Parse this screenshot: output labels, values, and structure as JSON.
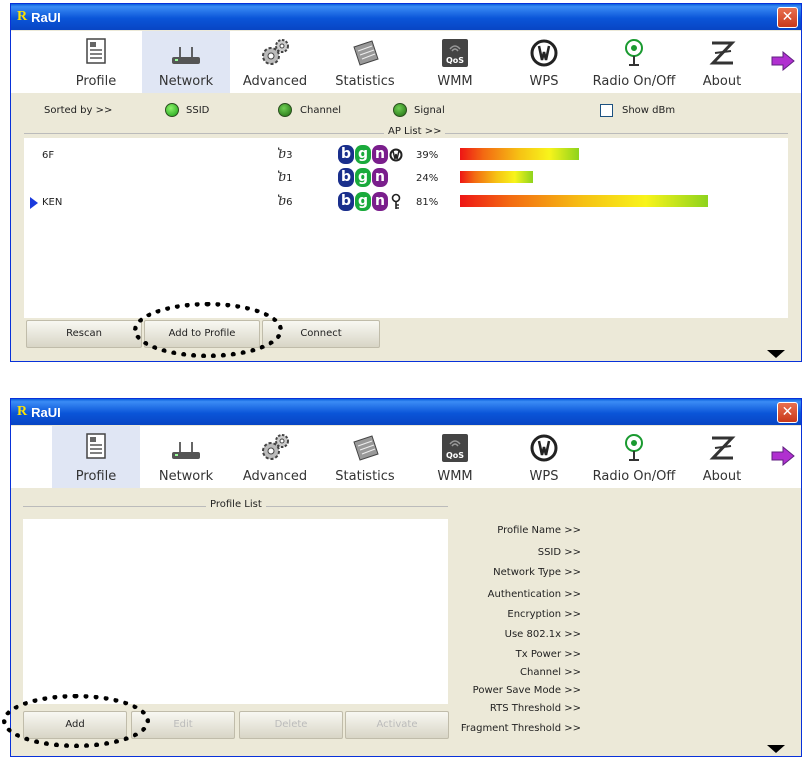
{
  "window1": {
    "title": "RaUI",
    "logo": "R",
    "close": "✕",
    "toolbar": [
      {
        "label": "Profile",
        "icon": "profile-icon",
        "active": false
      },
      {
        "label": "Network",
        "icon": "network-icon",
        "active": true
      },
      {
        "label": "Advanced",
        "icon": "advanced-icon",
        "active": false
      },
      {
        "label": "Statistics",
        "icon": "statistics-icon",
        "active": false
      },
      {
        "label": "WMM",
        "icon": "wmm-icon",
        "active": false
      },
      {
        "label": "WPS",
        "icon": "wps-icon",
        "active": false
      },
      {
        "label": "Radio On/Off",
        "icon": "radio-icon",
        "active": false
      },
      {
        "label": "About",
        "icon": "about-icon",
        "active": false
      }
    ],
    "sortbar": {
      "sorted_by": "Sorted by >>",
      "ssid": "SSID",
      "channel": "Channel",
      "signal": "Signal",
      "show_dbm": "Show dBm"
    },
    "ap_list_title": "AP List >>",
    "ap_list": [
      {
        "ssid": "6F",
        "channel": "3",
        "badges": [
          "b",
          "g",
          "n"
        ],
        "security": "wps",
        "signal_pct": "39%",
        "signal": 0.39,
        "selected": false
      },
      {
        "ssid": "",
        "channel": "1",
        "badges": [
          "b",
          "g",
          "n"
        ],
        "security": "",
        "signal_pct": "24%",
        "signal": 0.24,
        "selected": false
      },
      {
        "ssid": "KEN",
        "channel": "6",
        "badges": [
          "b",
          "g",
          "n"
        ],
        "security": "key",
        "signal_pct": "81%",
        "signal": 0.81,
        "selected": true
      }
    ],
    "buttons": {
      "rescan": "Rescan",
      "add_to_profile": "Add to Profile",
      "connect": "Connect"
    }
  },
  "window2": {
    "title": "RaUI",
    "logo": "R",
    "close": "✕",
    "toolbar": [
      {
        "label": "Profile",
        "active": true
      },
      {
        "label": "Network",
        "active": false
      },
      {
        "label": "Advanced",
        "active": false
      },
      {
        "label": "Statistics",
        "active": false
      },
      {
        "label": "WMM",
        "active": false
      },
      {
        "label": "WPS",
        "active": false
      },
      {
        "label": "Radio On/Off",
        "active": false
      },
      {
        "label": "About",
        "active": false
      }
    ],
    "profile_list_title": "Profile List",
    "buttons": {
      "add": "Add",
      "edit": "Edit",
      "delete": "Delete",
      "activate": "Activate"
    },
    "fields": {
      "profile_name": "Profile Name >>",
      "ssid": "SSID >>",
      "network_type": "Network Type >>",
      "authentication": "Authentication >>",
      "encryption": "Encryption >>",
      "use_8021x": "Use 802.1x >>",
      "tx_power": "Tx Power >>",
      "channel": "Channel >>",
      "power_save": "Power Save Mode >>",
      "rts": "RTS Threshold >>",
      "fragment": "Fragment Threshold >>"
    }
  },
  "icons": {
    "wmm_badge": "QoS"
  }
}
